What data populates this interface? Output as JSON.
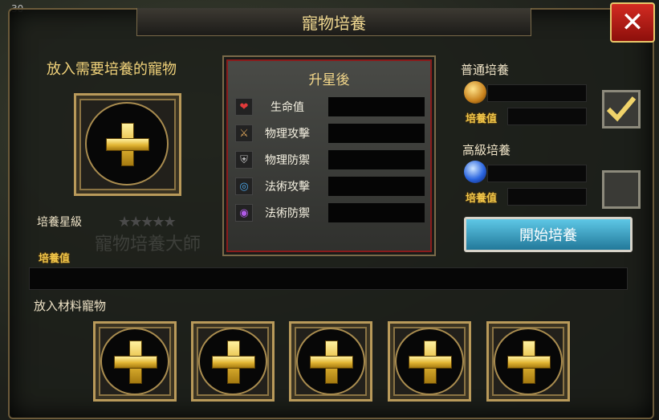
{
  "title": "寵物培養",
  "close_label": "✕",
  "hud_text": "30",
  "main_slot_label": "放入需要培養的寵物",
  "star_label": "培養星級",
  "stars": "★★★★★",
  "value_tag": "培養值",
  "watermark": "寵物培養大師",
  "stats": {
    "title": "升星後",
    "rows": [
      {
        "name": "生命值",
        "icon": "heart-icon",
        "glyph": "❤"
      },
      {
        "name": "物理攻擊",
        "icon": "sword-icon",
        "glyph": "⚔"
      },
      {
        "name": "物理防禦",
        "icon": "shield-icon",
        "glyph": "⛨"
      },
      {
        "name": "法術攻擊",
        "icon": "swirl-icon",
        "glyph": "◎"
      },
      {
        "name": "法術防禦",
        "icon": "orb-icon",
        "glyph": "◉"
      }
    ]
  },
  "normal": {
    "label": "普通培養",
    "tag": "培養值",
    "checked": true
  },
  "advanced": {
    "label": "高級培養",
    "tag": "培養值",
    "checked": false
  },
  "start_button": "開始培養",
  "materials_label": "放入材料寵物",
  "colors": {
    "gold": "#f1d27a",
    "button": "#2f9bc0",
    "close": "#c11d17"
  }
}
